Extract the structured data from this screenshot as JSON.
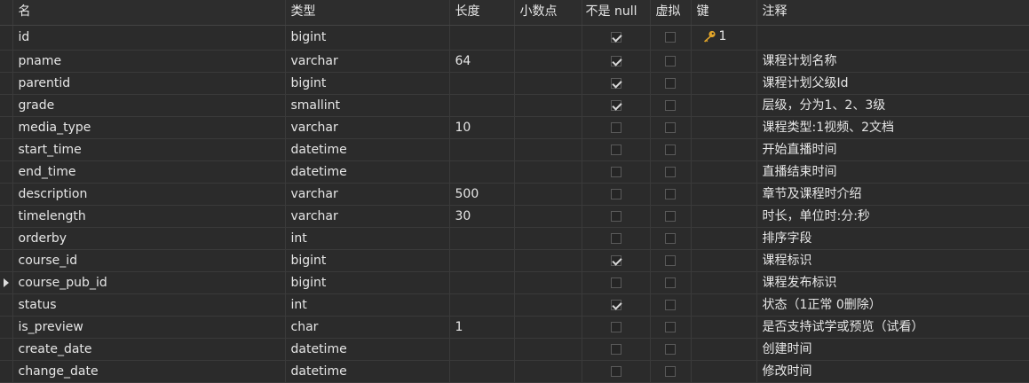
{
  "columns": [
    "名",
    "类型",
    "长度",
    "小数点",
    "不是 null",
    "虚拟",
    "键",
    "注释"
  ],
  "rows": [
    {
      "name": "id",
      "type": "bigint",
      "length": "",
      "decimals": "",
      "not_null": true,
      "virtual": false,
      "key": "1",
      "comment": ""
    },
    {
      "name": "pname",
      "type": "varchar",
      "length": "64",
      "decimals": "",
      "not_null": true,
      "virtual": false,
      "key": "",
      "comment": "课程计划名称"
    },
    {
      "name": "parentid",
      "type": "bigint",
      "length": "",
      "decimals": "",
      "not_null": true,
      "virtual": false,
      "key": "",
      "comment": "课程计划父级Id"
    },
    {
      "name": "grade",
      "type": "smallint",
      "length": "",
      "decimals": "",
      "not_null": true,
      "virtual": false,
      "key": "",
      "comment": "层级，分为1、2、3级"
    },
    {
      "name": "media_type",
      "type": "varchar",
      "length": "10",
      "decimals": "",
      "not_null": false,
      "virtual": false,
      "key": "",
      "comment": "课程类型:1视频、2文档"
    },
    {
      "name": "start_time",
      "type": "datetime",
      "length": "",
      "decimals": "",
      "not_null": false,
      "virtual": false,
      "key": "",
      "comment": "开始直播时间"
    },
    {
      "name": "end_time",
      "type": "datetime",
      "length": "",
      "decimals": "",
      "not_null": false,
      "virtual": false,
      "key": "",
      "comment": "直播结束时间"
    },
    {
      "name": "description",
      "type": "varchar",
      "length": "500",
      "decimals": "",
      "not_null": false,
      "virtual": false,
      "key": "",
      "comment": "章节及课程时介绍"
    },
    {
      "name": "timelength",
      "type": "varchar",
      "length": "30",
      "decimals": "",
      "not_null": false,
      "virtual": false,
      "key": "",
      "comment": "时长，单位时:分:秒"
    },
    {
      "name": "orderby",
      "type": "int",
      "length": "",
      "decimals": "",
      "not_null": false,
      "virtual": false,
      "key": "",
      "comment": "排序字段"
    },
    {
      "name": "course_id",
      "type": "bigint",
      "length": "",
      "decimals": "",
      "not_null": true,
      "virtual": false,
      "key": "",
      "comment": "课程标识"
    },
    {
      "name": "course_pub_id",
      "type": "bigint",
      "length": "",
      "decimals": "",
      "not_null": false,
      "virtual": false,
      "key": "",
      "comment": "课程发布标识",
      "current": true
    },
    {
      "name": "status",
      "type": "int",
      "length": "",
      "decimals": "",
      "not_null": true,
      "virtual": false,
      "key": "",
      "comment": "状态（1正常  0删除）"
    },
    {
      "name": "is_preview",
      "type": "char",
      "length": "1",
      "decimals": "",
      "not_null": false,
      "virtual": false,
      "key": "",
      "comment": "是否支持试学或预览（试看）"
    },
    {
      "name": "create_date",
      "type": "datetime",
      "length": "",
      "decimals": "",
      "not_null": false,
      "virtual": false,
      "key": "",
      "comment": "创建时间"
    },
    {
      "name": "change_date",
      "type": "datetime",
      "length": "",
      "decimals": "",
      "not_null": false,
      "virtual": false,
      "key": "",
      "comment": "修改时间"
    }
  ],
  "colors": {
    "key_icon": "#e2a52a"
  }
}
